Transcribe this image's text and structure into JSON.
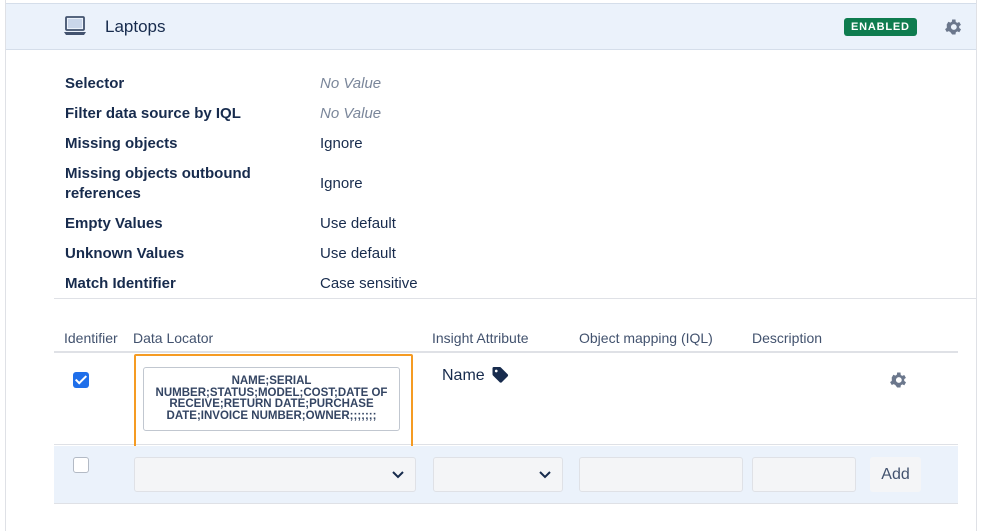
{
  "header": {
    "title": "Laptops",
    "status": "ENABLED",
    "status_color": "#0e7c4f",
    "icon": "laptop-icon",
    "settings_icon": "gear-icon"
  },
  "properties": [
    {
      "label": "Selector",
      "value": "No Value",
      "muted": true
    },
    {
      "label": "Filter data source by IQL",
      "value": "No Value",
      "muted": true
    },
    {
      "label": "Missing objects",
      "value": "Ignore",
      "muted": false
    },
    {
      "label": "Missing objects outbound references",
      "value": "Ignore",
      "muted": false
    },
    {
      "label": "Empty Values",
      "value": "Use default",
      "muted": false
    },
    {
      "label": "Unknown Values",
      "value": "Use default",
      "muted": false
    },
    {
      "label": "Match Identifier",
      "value": "Case sensitive",
      "muted": false
    }
  ],
  "table": {
    "columns": [
      "Identifier",
      "Data Locator",
      "Insight Attribute",
      "Object mapping (IQL)",
      "Description"
    ],
    "rows": [
      {
        "identifier_checked": true,
        "data_locator": "NAME;SERIAL NUMBER;STATUS;MODEL;COST;DATE OF RECEIVE;RETURN DATE;PURCHASE DATE;INVOICE NUMBER;OWNER;;;;;;;",
        "insight_attribute": "Name",
        "attribute_icon": "tag-icon",
        "object_mapping": "",
        "description": ""
      }
    ],
    "new_row": {
      "identifier_checked": false,
      "data_locator": "",
      "insight_attribute": "",
      "object_mapping": "",
      "description": "",
      "add_label": "Add"
    }
  },
  "colors": {
    "header_bg": "#ebf2fb",
    "highlight": "#f59b23",
    "checkbox": "#1f6fea"
  }
}
